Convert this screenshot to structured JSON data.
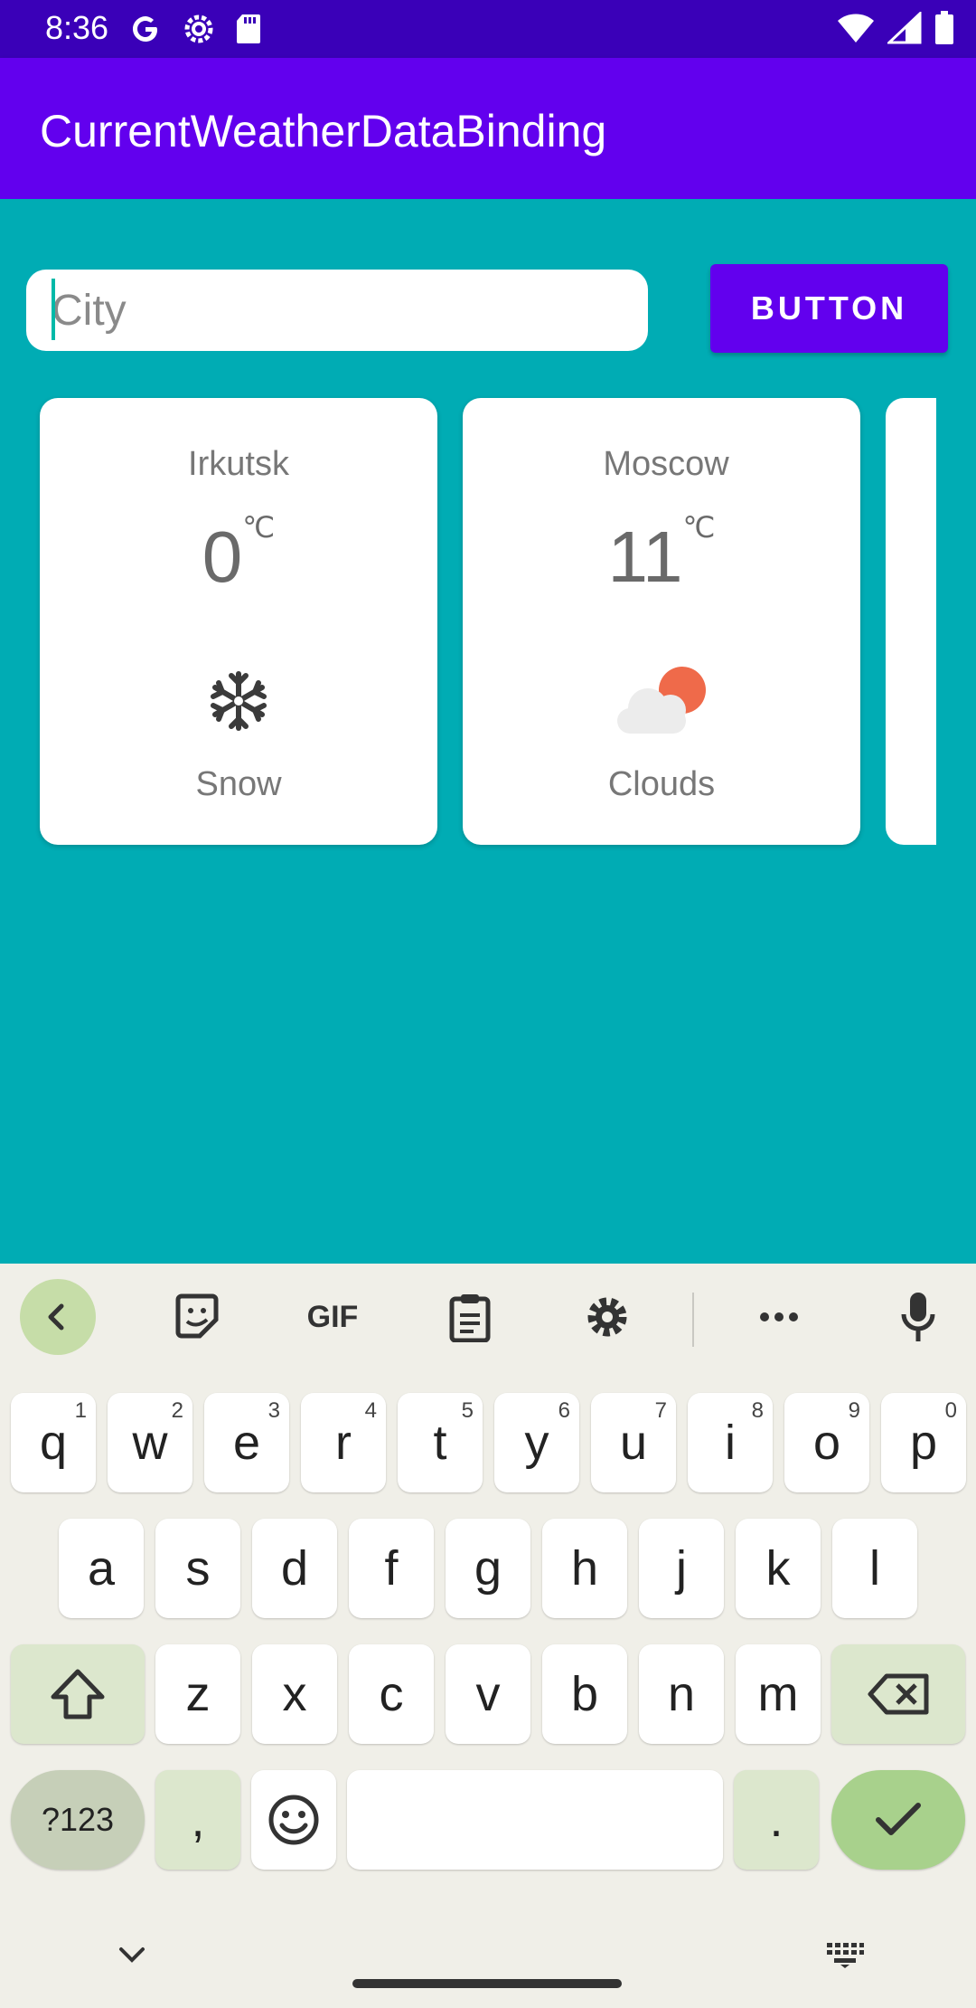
{
  "status_bar": {
    "time": "8:36"
  },
  "app_bar": {
    "title": "CurrentWeatherDataBinding"
  },
  "search": {
    "placeholder": "City",
    "value": ""
  },
  "action_button": {
    "label": "BUTTON"
  },
  "cards": [
    {
      "city": "Irkutsk",
      "temp": "0",
      "unit": "℃",
      "condition": "Snow",
      "icon": "snowflake-icon"
    },
    {
      "city": "Moscow",
      "temp": "11",
      "unit": "℃",
      "condition": "Clouds",
      "icon": "sun-behind-cloud-icon"
    }
  ],
  "keyboard": {
    "row1": [
      {
        "k": "q",
        "h": "1"
      },
      {
        "k": "w",
        "h": "2"
      },
      {
        "k": "e",
        "h": "3"
      },
      {
        "k": "r",
        "h": "4"
      },
      {
        "k": "t",
        "h": "5"
      },
      {
        "k": "y",
        "h": "6"
      },
      {
        "k": "u",
        "h": "7"
      },
      {
        "k": "i",
        "h": "8"
      },
      {
        "k": "o",
        "h": "9"
      },
      {
        "k": "p",
        "h": "0"
      }
    ],
    "row2": [
      "a",
      "s",
      "d",
      "f",
      "g",
      "h",
      "j",
      "k",
      "l"
    ],
    "row3": [
      "z",
      "x",
      "c",
      "v",
      "b",
      "n",
      "m"
    ],
    "symbols_label": "?123",
    "comma": ",",
    "period": ".",
    "toolbar_gif": "GIF"
  },
  "colors": {
    "app_bar": "#6200EE",
    "status_bar": "#3A00B8",
    "background": "#00ACB4",
    "accent": "#6200EE"
  }
}
